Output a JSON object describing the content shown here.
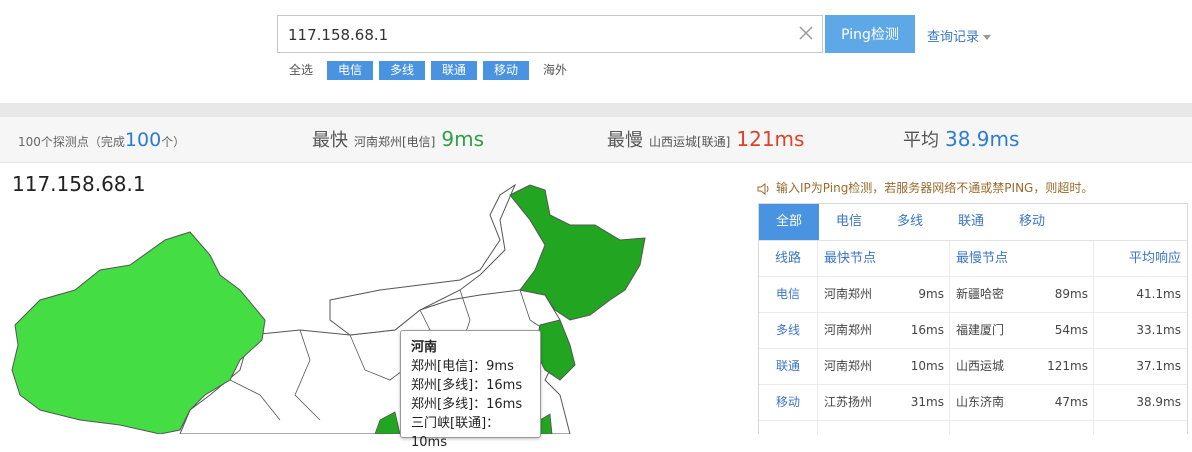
{
  "search": {
    "value": "117.158.68.1",
    "button_label": "Ping检测",
    "history_label": "查询记录"
  },
  "filters": {
    "select_all": "全选",
    "telecom": "电信",
    "multi": "多线",
    "unicom": "联通",
    "mobile": "移动",
    "overseas": "海外"
  },
  "summary": {
    "total_prefix": "100个探测点（完成",
    "total_done": "100",
    "total_suffix": "个）",
    "fastest_label": "最快",
    "fastest_loc": "河南郑州[电信]",
    "fastest_val": "9ms",
    "slowest_label": "最慢",
    "slowest_loc": "山西运城[联通]",
    "slowest_val": "121ms",
    "avg_label": "平均",
    "avg_val": "38.9ms"
  },
  "map": {
    "ip_title": "117.158.68.1",
    "tooltip": {
      "title": "河南",
      "lines": [
        "郑州[电信]：9ms",
        "郑州[多线]：16ms",
        "郑州[多线]：16ms",
        "三门峡[联通]：10ms"
      ]
    },
    "colors": {
      "light_green": "#44dd44",
      "dark_green": "#22a622",
      "border": "#555555"
    }
  },
  "notice": "输入IP为Ping检测，若服务器网络不通或禁PING，则超时。",
  "tabs": [
    "全部",
    "电信",
    "多线",
    "联通",
    "移动"
  ],
  "table": {
    "headers": {
      "line": "线路",
      "fastest": "最快节点",
      "slowest": "最慢节点",
      "avg": "平均响应"
    },
    "rows": [
      {
        "isp": "电信",
        "fast_loc": "河南郑州",
        "fast_ms": "9ms",
        "slow_loc": "新疆哈密",
        "slow_ms": "89ms",
        "avg": "41.1ms"
      },
      {
        "isp": "多线",
        "fast_loc": "河南郑州",
        "fast_ms": "16ms",
        "slow_loc": "福建厦门",
        "slow_ms": "54ms",
        "avg": "33.1ms"
      },
      {
        "isp": "联通",
        "fast_loc": "河南郑州",
        "fast_ms": "10ms",
        "slow_loc": "山西运城",
        "slow_ms": "121ms",
        "avg": "37.1ms"
      },
      {
        "isp": "移动",
        "fast_loc": "江苏扬州",
        "fast_ms": "31ms",
        "slow_loc": "山东济南",
        "slow_ms": "47ms",
        "avg": "38.9ms"
      }
    ]
  }
}
